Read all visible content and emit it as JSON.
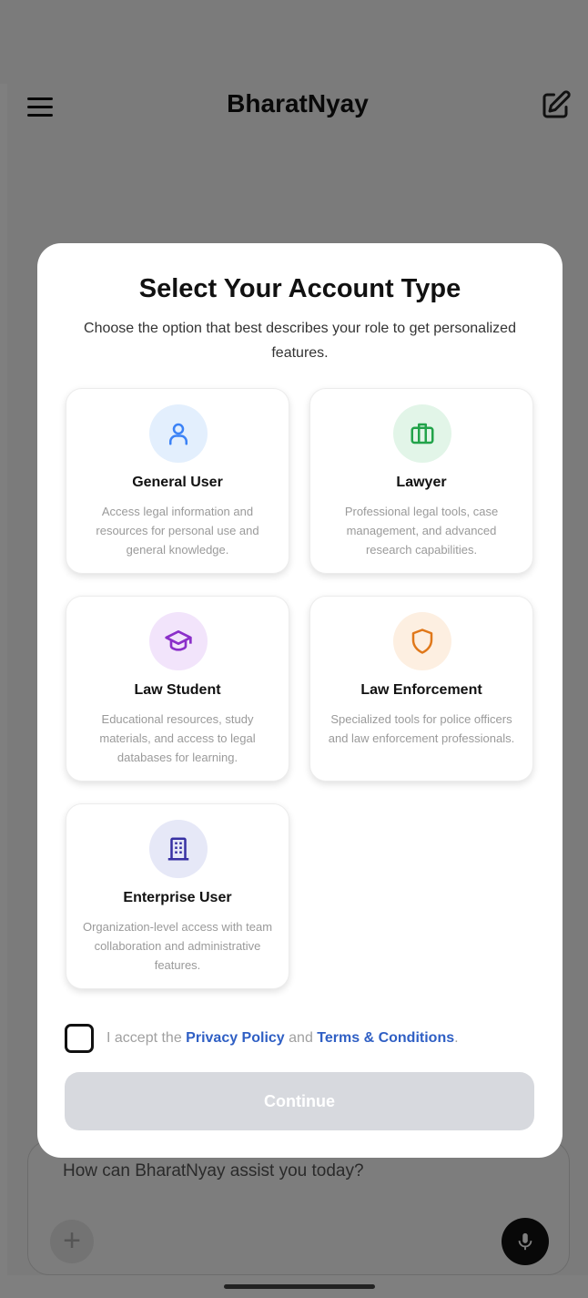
{
  "header": {
    "app_title": "BharatNyay"
  },
  "composer": {
    "placeholder": "How can BharatNyay assist you today?"
  },
  "modal": {
    "title": "Select Your Account Type",
    "subtitle": "Choose the option that best describes your role to get personalized features.",
    "account_types": [
      {
        "label": "General User",
        "description": "Access legal information and resources for personal use and general knowledge.",
        "icon": "user-icon",
        "icon_color": "#3b82f6",
        "icon_bg": "#e3effd"
      },
      {
        "label": "Lawyer",
        "description": "Professional legal tools, case management, and advanced research capabilities.",
        "icon": "briefcase-icon",
        "icon_color": "#22a34a",
        "icon_bg": "#e2f5e8"
      },
      {
        "label": "Law Student",
        "description": "Educational resources, study materials, and access to legal databases for learning.",
        "icon": "graduation-cap-icon",
        "icon_color": "#8b2fc9",
        "icon_bg": "#f2e4fb"
      },
      {
        "label": "Law Enforcement",
        "description": "Specialized tools for police officers and law enforcement professionals.",
        "icon": "shield-icon",
        "icon_color": "#e0781a",
        "icon_bg": "#fdefe1"
      },
      {
        "label": "Enterprise User",
        "description": "Organization-level access with team collaboration and administrative features.",
        "icon": "building-icon",
        "icon_color": "#3730a3",
        "icon_bg": "#e6e8f7"
      }
    ],
    "terms": {
      "prefix": "I accept the",
      "privacy_link": "Privacy Policy",
      "connector": "and",
      "terms_link": "Terms & Conditions",
      "suffix": ".",
      "checked": false
    },
    "continue_label": "Continue"
  }
}
